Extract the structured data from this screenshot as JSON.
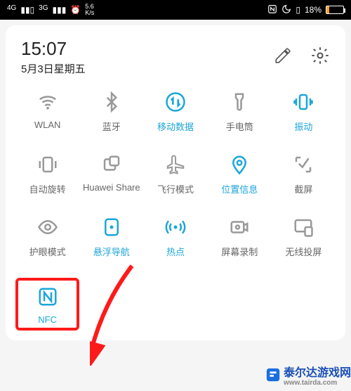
{
  "status": {
    "left": {
      "net1": "4G",
      "net2": "3G",
      "speed_top": "5.6",
      "speed_bottom": "K/s"
    },
    "right": {
      "battery_percent": "18%"
    }
  },
  "header": {
    "time": "15:07",
    "date": "5月3日星期五"
  },
  "tiles": {
    "row1": [
      {
        "label": "WLAN",
        "icon": "wifi-icon",
        "active": false
      },
      {
        "label": "蓝牙",
        "icon": "bluetooth-icon",
        "active": false
      },
      {
        "label": "移动数据",
        "icon": "mobile-data-icon",
        "active": true
      },
      {
        "label": "手电筒",
        "icon": "flashlight-icon",
        "active": false
      },
      {
        "label": "振动",
        "icon": "vibrate-icon",
        "active": true
      }
    ],
    "row2": [
      {
        "label": "自动旋转",
        "icon": "auto-rotate-icon",
        "active": false
      },
      {
        "label": "Huawei Share",
        "icon": "huawei-share-icon",
        "active": false
      },
      {
        "label": "飞行模式",
        "icon": "airplane-icon",
        "active": false
      },
      {
        "label": "位置信息",
        "icon": "location-icon",
        "active": true
      },
      {
        "label": "截屏",
        "icon": "screenshot-icon",
        "active": false
      }
    ],
    "row3": [
      {
        "label": "护眼模式",
        "icon": "eye-comfort-icon",
        "active": false
      },
      {
        "label": "悬浮导航",
        "icon": "floating-nav-icon",
        "active": true
      },
      {
        "label": "热点",
        "icon": "hotspot-icon",
        "active": true
      },
      {
        "label": "屏幕录制",
        "icon": "screen-record-icon",
        "active": false
      },
      {
        "label": "无线投屏",
        "icon": "wireless-projection-icon",
        "active": false
      }
    ],
    "row4": [
      {
        "label": "NFC",
        "icon": "nfc-icon",
        "active": true,
        "highlight": true
      }
    ]
  },
  "watermark": {
    "text": "泰尔达游戏网",
    "url": "www.tairda.com"
  }
}
